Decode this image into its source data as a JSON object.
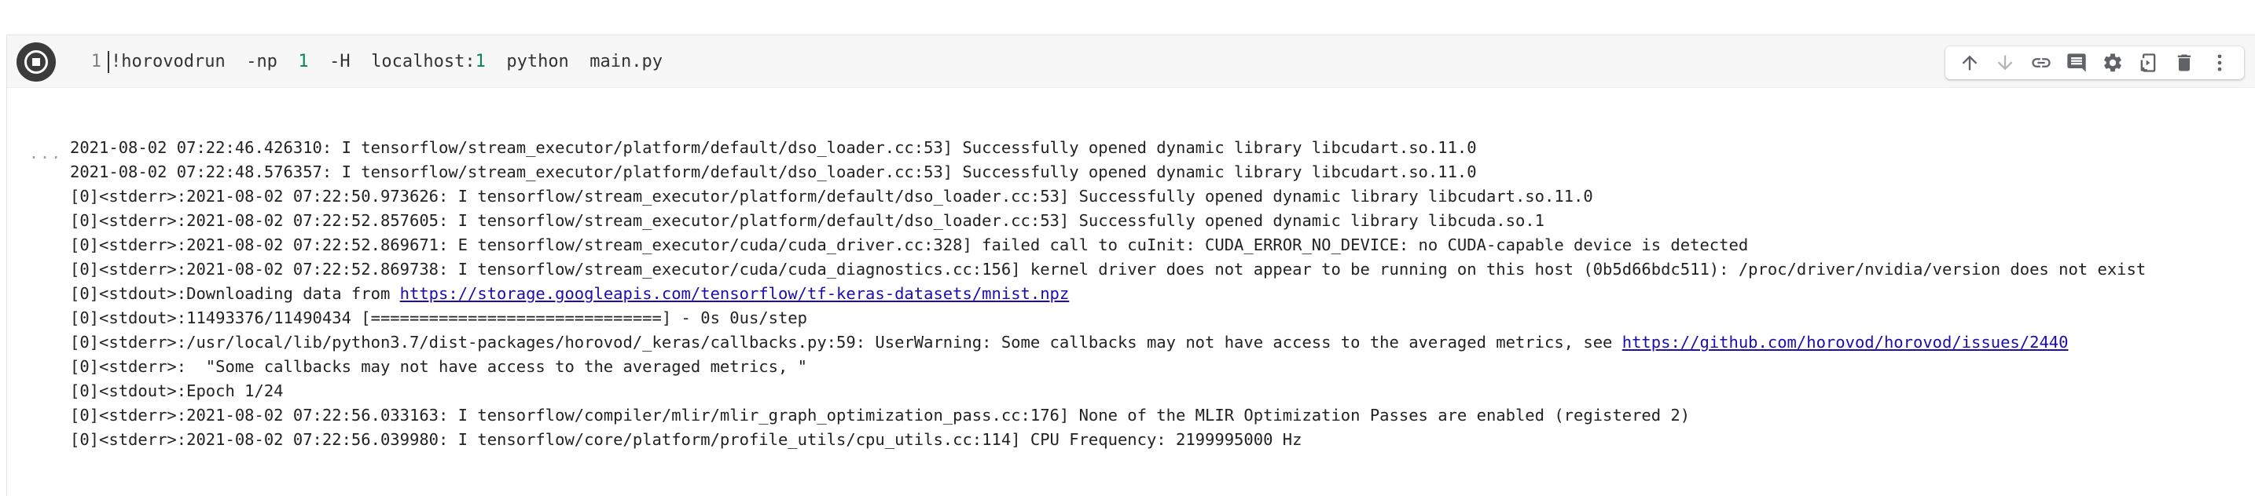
{
  "code_cell": {
    "line_number": "1",
    "tokens": [
      {
        "text": "!horovodrun",
        "kind": "cmd"
      },
      {
        "text": "  -np  ",
        "kind": "op"
      },
      {
        "text": "1",
        "kind": "num"
      },
      {
        "text": "  -H  localhost:",
        "kind": "op"
      },
      {
        "text": "1",
        "kind": "num"
      },
      {
        "text": "  python  main.py",
        "kind": "op"
      }
    ]
  },
  "toolbar": {
    "icons": [
      {
        "name": "arrow-up-icon",
        "interactable": true
      },
      {
        "name": "arrow-down-icon",
        "interactable": true
      },
      {
        "name": "link-icon",
        "interactable": true
      },
      {
        "name": "comment-icon",
        "interactable": true
      },
      {
        "name": "gear-icon",
        "interactable": true
      },
      {
        "name": "mirror-cell-icon",
        "interactable": true
      },
      {
        "name": "trash-icon",
        "interactable": true
      },
      {
        "name": "more-vert-icon",
        "interactable": true
      }
    ],
    "icon_color": "#5f6368",
    "disabled_color": "#b5b5b5"
  },
  "output": {
    "dots": "...",
    "lines": [
      {
        "text": "2021-08-02 07:22:46.426310: I tensorflow/stream_executor/platform/default/dso_loader.cc:53] Successfully opened dynamic library libcudart.so.11.0"
      },
      {
        "text": "2021-08-02 07:22:48.576357: I tensorflow/stream_executor/platform/default/dso_loader.cc:53] Successfully opened dynamic library libcudart.so.11.0"
      },
      {
        "text": "[0]<stderr>:2021-08-02 07:22:50.973626: I tensorflow/stream_executor/platform/default/dso_loader.cc:53] Successfully opened dynamic library libcudart.so.11.0"
      },
      {
        "text": "[0]<stderr>:2021-08-02 07:22:52.857605: I tensorflow/stream_executor/platform/default/dso_loader.cc:53] Successfully opened dynamic library libcuda.so.1"
      },
      {
        "text": "[0]<stderr>:2021-08-02 07:22:52.869671: E tensorflow/stream_executor/cuda/cuda_driver.cc:328] failed call to cuInit: CUDA_ERROR_NO_DEVICE: no CUDA-capable device is detected"
      },
      {
        "text": "[0]<stderr>:2021-08-02 07:22:52.869738: I tensorflow/stream_executor/cuda/cuda_diagnostics.cc:156] kernel driver does not appear to be running on this host (0b5d66bdc511): /proc/driver/nvidia/version does not exist"
      },
      {
        "text": "[0]<stdout>:Downloading data from ",
        "link": "https://storage.googleapis.com/tensorflow/tf-keras-datasets/mnist.npz"
      },
      {
        "text": "[0]<stdout>:11493376/11490434 [==============================] - 0s 0us/step"
      },
      {
        "text": "[0]<stderr>:/usr/local/lib/python3.7/dist-packages/horovod/_keras/callbacks.py:59: UserWarning: Some callbacks may not have access to the averaged metrics, see ",
        "link": "https://github.com/horovod/horovod/issues/2440"
      },
      {
        "text": "[0]<stderr>:  \"Some callbacks may not have access to the averaged metrics, \""
      },
      {
        "text": "[0]<stdout>:Epoch 1/24"
      },
      {
        "text": "[0]<stderr>:2021-08-02 07:22:56.033163: I tensorflow/compiler/mlir/mlir_graph_optimization_pass.cc:176] None of the MLIR Optimization Passes are enabled (registered 2)"
      },
      {
        "text": "[0]<stderr>:2021-08-02 07:22:56.039980: I tensorflow/core/platform/profile_utils/cpu_utils.cc:114] CPU Frequency: 2199995000 Hz"
      }
    ]
  }
}
